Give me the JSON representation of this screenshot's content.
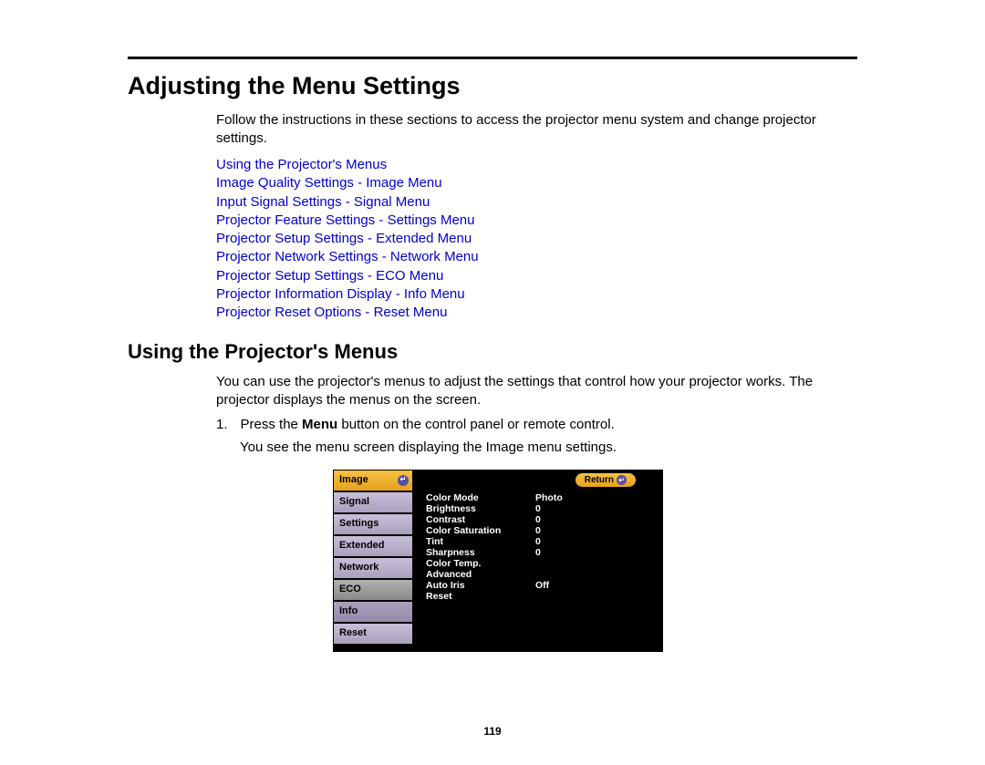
{
  "page": {
    "title": "Adjusting the Menu Settings",
    "intro": "Follow the instructions in these sections to access the projector menu system and change projector settings.",
    "page_number": "119"
  },
  "links": [
    "Using the Projector's Menus",
    "Image Quality Settings - Image Menu",
    "Input Signal Settings - Signal Menu",
    "Projector Feature Settings - Settings Menu",
    "Projector Setup Settings - Extended Menu",
    "Projector Network Settings - Network Menu",
    "Projector Setup Settings - ECO Menu",
    "Projector Information Display - Info Menu",
    "Projector Reset Options - Reset Menu"
  ],
  "section2": {
    "title": "Using the Projector's Menus",
    "intro": "You can use the projector's menus to adjust the settings that control how your projector works. The projector displays the menus on the screen.",
    "step1_num": "1.",
    "step1_pre": "Press the ",
    "step1_bold": "Menu",
    "step1_post": " button on the control panel or remote control.",
    "step1_note": "You see the menu screen displaying the Image menu settings."
  },
  "projector_menu": {
    "tabs": [
      "Image",
      "Signal",
      "Settings",
      "Extended",
      "Network",
      "ECO",
      "Info",
      "Reset"
    ],
    "return_label": "Return",
    "settings": [
      {
        "label": "Color Mode",
        "value": "Photo"
      },
      {
        "label": "Brightness",
        "value": "0"
      },
      {
        "label": "Contrast",
        "value": "0"
      },
      {
        "label": "Color Saturation",
        "value": "0"
      },
      {
        "label": "Tint",
        "value": "0"
      },
      {
        "label": "Sharpness",
        "value": "0"
      },
      {
        "label": "Color Temp.",
        "value": ""
      },
      {
        "label": "Advanced",
        "value": ""
      },
      {
        "label": "Auto Iris",
        "value": "Off"
      },
      {
        "label": "Reset",
        "value": ""
      }
    ]
  }
}
